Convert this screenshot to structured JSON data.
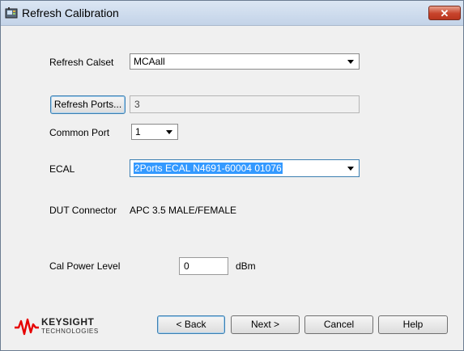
{
  "window": {
    "title": "Refresh Calibration",
    "close_glyph": "✕"
  },
  "refresh_calset": {
    "label": "Refresh Calset",
    "value": "MCAall"
  },
  "refresh_ports": {
    "button_label": "Refresh Ports...",
    "value": "3"
  },
  "common_port": {
    "label": "Common Port",
    "value": "1"
  },
  "ecal": {
    "label": "ECAL",
    "value": "2Ports ECAL N4691-60004 01076"
  },
  "dut_connector": {
    "label": "DUT Connector",
    "value": "APC 3.5 MALE/FEMALE"
  },
  "cal_power": {
    "label": "Cal Power Level",
    "value": "0",
    "unit": "dBm"
  },
  "logo": {
    "name": "KEYSIGHT",
    "sub": "TECHNOLOGIES",
    "color": "#e60000"
  },
  "buttons": {
    "back": "< Back",
    "next": "Next >",
    "cancel": "Cancel",
    "help": "Help"
  },
  "icons": {
    "app": "calibration-app-icon",
    "close": "close-icon",
    "dropdown": "chevron-down-icon"
  }
}
